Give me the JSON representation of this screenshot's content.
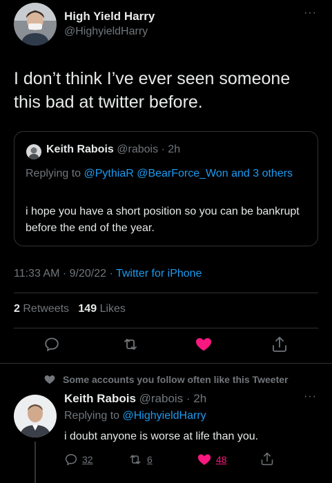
{
  "main_tweet": {
    "author_name": "High Yield Harry",
    "author_handle": "@HighyieldHarry",
    "more": "···",
    "text": "I don’t think I’ve ever seen someone this bad at twitter before.",
    "time": "11:33 AM",
    "date": "9/20/22",
    "source": "Twitter for iPhone",
    "retweets_count": "2",
    "retweets_label": "Retweets",
    "likes_count": "149",
    "likes_label": "Likes",
    "liked": true
  },
  "quoted_tweet": {
    "author_name": "Keith Rabois",
    "author_handle": "@rabois",
    "age": "2h",
    "replying_prefix": "Replying to",
    "replying_to": "@PythiaR @BearForce_Won and 3 others",
    "text": "i hope you have a short position so you can be bankrupt before the end of the year."
  },
  "reply": {
    "social_context": "Some accounts you follow often like this Tweeter",
    "author_name": "Keith Rabois",
    "author_handle": "@rabois",
    "age": "2h",
    "more": "···",
    "replying_prefix": "Replying to",
    "replying_to": "@HighyieldHarry",
    "text": "i doubt anyone is worse at life than you.",
    "reply_count": "32",
    "retweet_count": "6",
    "like_count": "48"
  },
  "colors": {
    "background": "#000000",
    "accent": "#1d9bf0",
    "like": "#f91880",
    "secondary_text": "#71767b"
  },
  "icons": {
    "reply": "reply-icon",
    "retweet": "retweet-icon",
    "like": "heart-icon",
    "share": "share-icon",
    "more": "more-icon"
  }
}
